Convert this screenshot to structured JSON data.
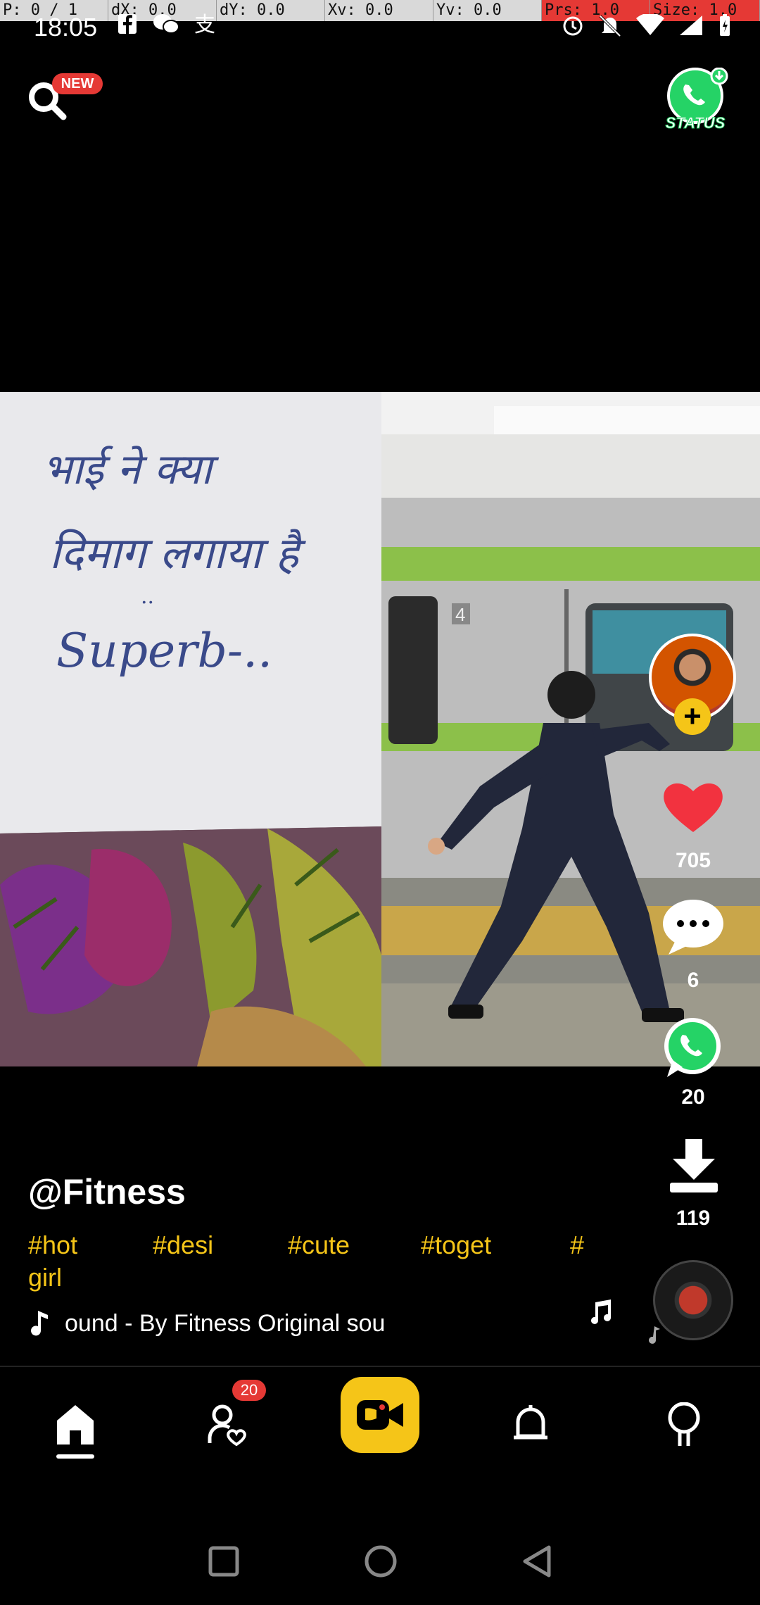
{
  "debug": {
    "segments": [
      {
        "text": "P: 0 / 1",
        "red": false
      },
      {
        "text": "dX: 0.0",
        "red": false
      },
      {
        "text": "dY: 0.0",
        "red": false
      },
      {
        "text": "Xv: 0.0",
        "red": false
      },
      {
        "text": "Yv: 0.0",
        "red": false
      },
      {
        "text": "Prs: 1.0",
        "red": true
      },
      {
        "text": "Size: 1.0",
        "red": true
      }
    ]
  },
  "status_bar": {
    "time": "18:05"
  },
  "top": {
    "new_badge": "NEW",
    "status_label": "STATUS"
  },
  "video": {
    "handwriting": {
      "line1": "भाई ने क्या",
      "line2": "दिमाग लगाया है",
      "line3": "..",
      "line4": "Superb-.."
    },
    "train_number": "4"
  },
  "actions": {
    "likes": "705",
    "comments": "6",
    "shares": "20",
    "downloads": "119"
  },
  "caption": {
    "username": "@Fitness",
    "tags": [
      "#hot",
      "#desi",
      "#cute",
      "#toget",
      "#",
      "girl"
    ],
    "sound": "ound - By Fitness   Original sou"
  },
  "nav": {
    "badge_count": "20"
  },
  "colors": {
    "accent_yellow": "#f5c518",
    "badge_red": "#e53935",
    "like_red": "#f2323f",
    "whatsapp_green": "#25d366"
  }
}
